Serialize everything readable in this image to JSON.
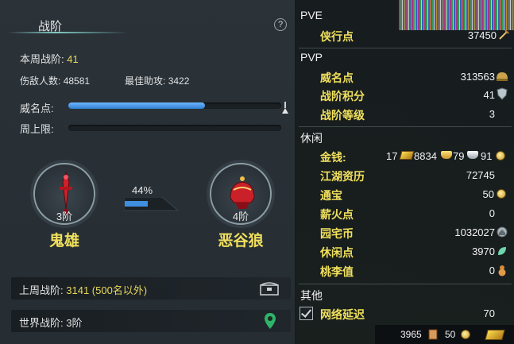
{
  "left_panel": {
    "title": "战阶",
    "help": "?",
    "weekly_rank_label": "本周战阶:",
    "weekly_rank_value": "41",
    "kills_label": "伤敌人数:",
    "kills_value": "48581",
    "best_assist_label": "最佳助攻:",
    "best_assist_value": "3422",
    "prestige_label": "威名点:",
    "prestige_progress": 0.64,
    "weekly_cap_label": "周上限:",
    "weekly_cap_progress": 0.0,
    "current_emblem": {
      "rank": "3阶",
      "name": "鬼雄"
    },
    "next_emblem": {
      "rank": "4阶",
      "name": "恶谷狼"
    },
    "progress_percent_text": "44%",
    "progress_fraction": 0.44,
    "last_week_label": "上周战阶:",
    "last_week_value": "3141 (500名以外)",
    "world_rank_label": "世界战阶:",
    "world_rank_value": "3阶"
  },
  "right_panel": {
    "pve": {
      "header": "PVE",
      "items": [
        {
          "label": "侠行点",
          "value": "37450",
          "icon": "sword-icon"
        }
      ]
    },
    "pvp": {
      "header": "PVP",
      "items": [
        {
          "label": "威名点",
          "value": "313563",
          "icon": "helmet-icon"
        },
        {
          "label": "战阶积分",
          "value": "41",
          "icon": "shield-icon"
        },
        {
          "label": "战阶等级",
          "value": "3",
          "icon": ""
        }
      ]
    },
    "leisure": {
      "header": "休闲",
      "money_label": "金钱:",
      "money_gold_bars": "17",
      "money_gold": "8834",
      "money_silver": "79",
      "money_copper": "91",
      "items": [
        {
          "label": "江湖资历",
          "value": "72745",
          "icon": ""
        },
        {
          "label": "通宝",
          "value": "50",
          "icon": "coin-icon"
        },
        {
          "label": "薪火点",
          "value": "0",
          "icon": ""
        },
        {
          "label": "园宅币",
          "value": "1032027",
          "icon": "house-coin-icon"
        },
        {
          "label": "休闲点",
          "value": "3970",
          "icon": "leaf-icon"
        },
        {
          "label": "桃李值",
          "value": "0",
          "icon": "gourd-icon"
        }
      ]
    },
    "other": {
      "header": "其他",
      "network_label": "网络延迟",
      "network_value": "70",
      "network_checked": true
    },
    "bottom_bar": {
      "stamina": "3965",
      "coins": "50"
    }
  },
  "colors": {
    "gold_text": "#f0e05c",
    "bar_blue": "#3f8ee0",
    "panel_bg": "#283036"
  }
}
